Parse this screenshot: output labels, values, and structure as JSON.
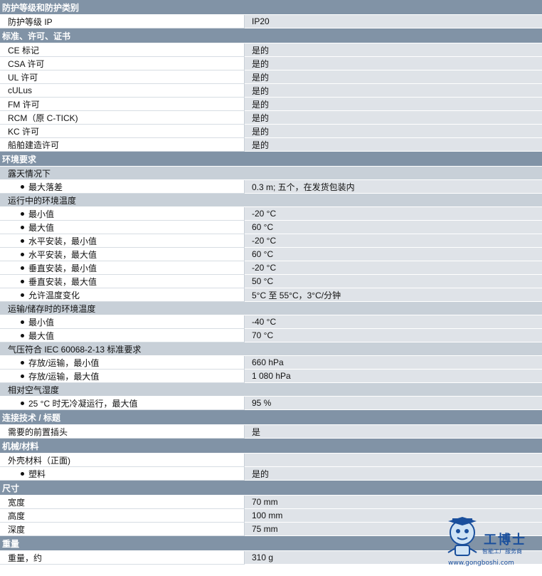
{
  "sections": [
    {
      "type": "sec",
      "label": "防护等级和防护类别"
    },
    {
      "type": "item",
      "key": "防护等级 IP",
      "value": "IP20"
    },
    {
      "type": "sec",
      "label": "标准、许可、证书"
    },
    {
      "type": "item",
      "key": "CE 标记",
      "value": "是的"
    },
    {
      "type": "item",
      "key": "CSA 许可",
      "value": "是的"
    },
    {
      "type": "item",
      "key": "UL 许可",
      "value": "是的"
    },
    {
      "type": "item",
      "key": "cULus",
      "value": "是的"
    },
    {
      "type": "item",
      "key": "FM 许可",
      "value": "是的"
    },
    {
      "type": "item",
      "key": "RCM（原 C-TICK)",
      "value": "是的"
    },
    {
      "type": "item",
      "key": "KC 许可",
      "value": "是的"
    },
    {
      "type": "item",
      "key": "船舶建造许可",
      "value": "是的"
    },
    {
      "type": "sec",
      "label": "环境要求"
    },
    {
      "type": "sub",
      "label": "露天情况下"
    },
    {
      "type": "bullet",
      "key": "最大落差",
      "value": "0.3 m; 五个，在发货包装内"
    },
    {
      "type": "sub",
      "label": "运行中的环境温度"
    },
    {
      "type": "bullet",
      "key": "最小值",
      "value": "-20 °C"
    },
    {
      "type": "bullet",
      "key": "最大值",
      "value": "60 °C"
    },
    {
      "type": "bullet",
      "key": "水平安装，最小值",
      "value": "-20 °C"
    },
    {
      "type": "bullet",
      "key": "水平安装，最大值",
      "value": "60 °C"
    },
    {
      "type": "bullet",
      "key": "垂直安装，最小值",
      "value": "-20 °C"
    },
    {
      "type": "bullet",
      "key": "垂直安装，最大值",
      "value": "50 °C"
    },
    {
      "type": "bullet",
      "key": "允许温度变化",
      "value": "5°C 至 55°C，3°C/分钟"
    },
    {
      "type": "sub",
      "label": "运输/储存时的环境温度"
    },
    {
      "type": "bullet",
      "key": "最小值",
      "value": "-40 °C"
    },
    {
      "type": "bullet",
      "key": "最大值",
      "value": "70 °C"
    },
    {
      "type": "sub",
      "label": "气压符合 IEC 60068-2-13 标准要求"
    },
    {
      "type": "bullet",
      "key": "存放/运输，最小值",
      "value": "660 hPa"
    },
    {
      "type": "bullet",
      "key": "存放/运输，最大值",
      "value": "1 080 hPa"
    },
    {
      "type": "sub",
      "label": "相对空气湿度"
    },
    {
      "type": "bullet",
      "key": "25 °C 时无冷凝运行，最大值",
      "value": "95 %"
    },
    {
      "type": "sec",
      "label": "连接技术 / 标题"
    },
    {
      "type": "item",
      "key": "需要的前置插头",
      "value": "是"
    },
    {
      "type": "sec",
      "label": "机械/材料"
    },
    {
      "type": "item",
      "key": "外壳材料（正面)",
      "value": ""
    },
    {
      "type": "bullet",
      "key": "塑料",
      "value": "是的"
    },
    {
      "type": "sec",
      "label": "尺寸"
    },
    {
      "type": "item",
      "key": "宽度",
      "value": "70 mm"
    },
    {
      "type": "item",
      "key": "高度",
      "value": "100 mm"
    },
    {
      "type": "item",
      "key": "深度",
      "value": "75 mm"
    },
    {
      "type": "sec",
      "label": "重量"
    },
    {
      "type": "item",
      "key": "重量，约",
      "value": "310 g"
    }
  ],
  "watermark": {
    "brand": "工博士",
    "tagline": "智能工厂服务商",
    "url": "www.gongboshi.com",
    "color": "#1a4f9c"
  }
}
